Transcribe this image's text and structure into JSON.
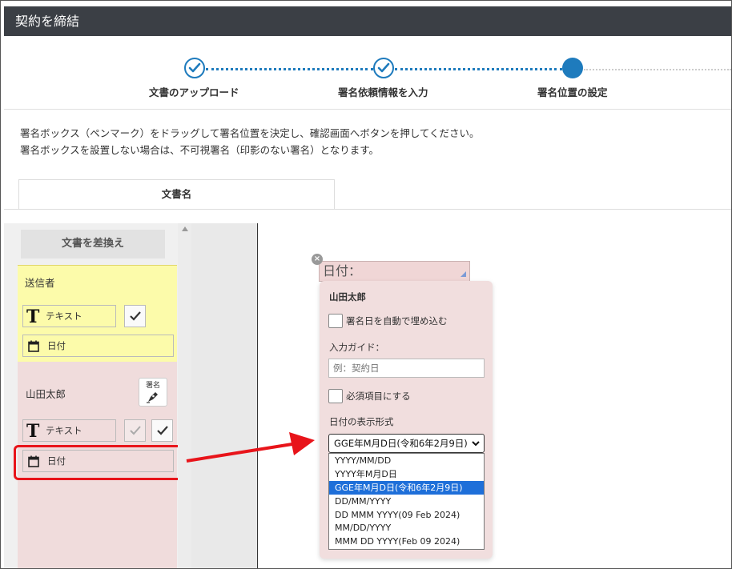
{
  "window": {
    "title": "契約を締結"
  },
  "stepper": {
    "steps": [
      {
        "label": "文書のアップロード",
        "state": "done"
      },
      {
        "label": "署名依頼情報を入力",
        "state": "done"
      },
      {
        "label": "署名位置の設定",
        "state": "active"
      }
    ]
  },
  "instructions": {
    "line1": "署名ボックス（ペンマーク）をドラッグして署名位置を決定し、確認画面へボタンを押してください。",
    "line2": "署名ボックスを設置しない場合は、不可視署名（印影のない署名）となります。"
  },
  "tabs": {
    "doc_tab": "文書名"
  },
  "left_panel": {
    "replace_button": "文書を差換え",
    "sender": {
      "label": "送信者",
      "text_field": "テキスト",
      "date_field": "日付"
    },
    "user": {
      "name": "山田太郎",
      "sign_button": "署名",
      "text_field": "テキスト",
      "date_field": "日付"
    }
  },
  "document": {
    "date_box_label": "日付："
  },
  "popup": {
    "name": "山田太郎",
    "auto_fill_label": "署名日を自動で埋め込む",
    "guide_label": "入力ガイド：",
    "guide_placeholder": "例：契約日",
    "required_label": "必須項目にする",
    "format_label": "日付の表示形式",
    "selected_format": "GGE年M月D日(令和6年2月9日)",
    "options": [
      "YYYY/MM/DD",
      "YYYY年M月D日",
      "GGE年M月D日(令和6年2月9日)",
      "DD/MM/YYYY",
      "DD MMM YYYY(09 Feb 2024)",
      "MM/DD/YYYY",
      "MMM DD YYYY(Feb 09 2024)"
    ]
  },
  "colors": {
    "accent": "#1e7bbd",
    "titlebar": "#3b3f45",
    "sender_bg": "#fcfbaa",
    "user_bg": "#f0dcdc",
    "highlight": "#e8141a"
  }
}
